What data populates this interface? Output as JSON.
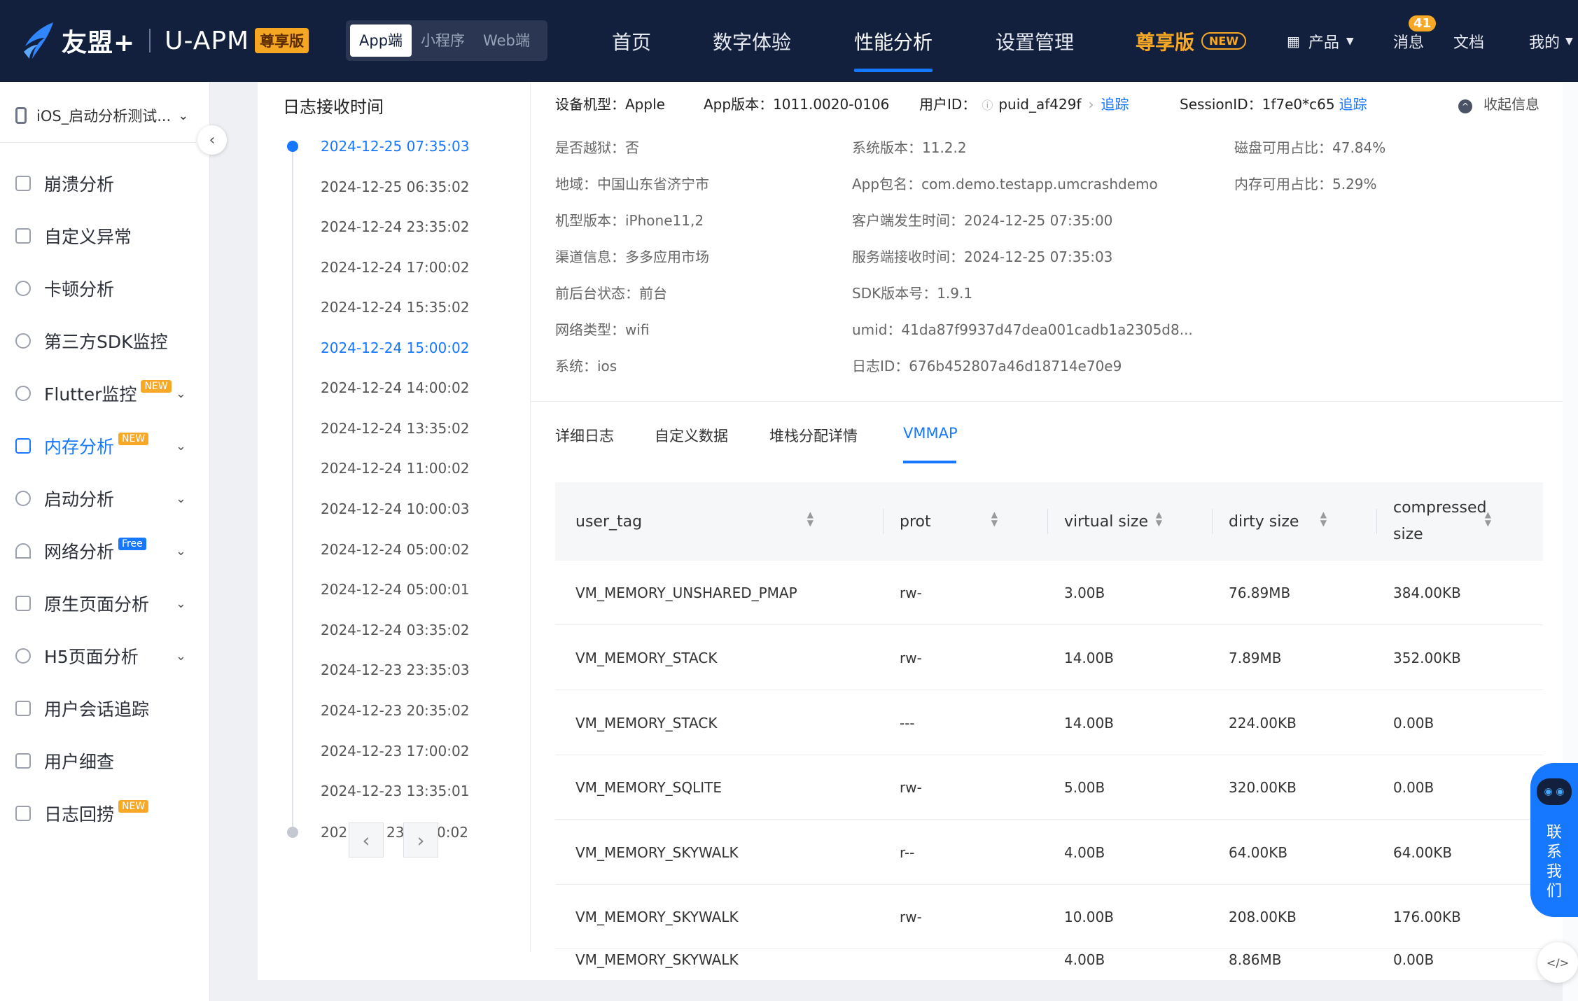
{
  "header": {
    "brand_name": "友盟+",
    "product_name": "U-APM",
    "edition_badge": "尊享版",
    "platform_tabs": [
      "App端",
      "小程序",
      "Web端"
    ],
    "menu": [
      "首页",
      "数字体验",
      "性能分析",
      "设置管理"
    ],
    "active_menu": "性能分析",
    "pro_menu": "尊享版",
    "pro_new": "NEW",
    "products": "产品",
    "messages": "消息",
    "message_count": "41",
    "docs": "文档",
    "mine": "我的"
  },
  "sidebar": {
    "app_name": "iOS_启动分析测试...",
    "items": [
      {
        "label": "崩溃分析",
        "icon": "crash-icon"
      },
      {
        "label": "自定义异常",
        "icon": "chart-icon"
      },
      {
        "label": "卡顿分析",
        "icon": "clock-icon"
      },
      {
        "label": "第三方SDK监控",
        "icon": "sdk-icon"
      },
      {
        "label": "Flutter监控",
        "icon": "flutter-icon",
        "tag": "NEW"
      },
      {
        "label": "内存分析",
        "icon": "save-icon",
        "tag": "NEW",
        "active": true
      },
      {
        "label": "启动分析",
        "icon": "power-icon"
      },
      {
        "label": "网络分析",
        "icon": "wifi-icon",
        "tag": "Free"
      },
      {
        "label": "原生页面分析",
        "icon": "page-icon"
      },
      {
        "label": "H5页面分析",
        "icon": "h5-icon"
      },
      {
        "label": "用户会话追踪",
        "icon": "session-icon"
      },
      {
        "label": "用户细查",
        "icon": "user-icon"
      },
      {
        "label": "日志回捞",
        "icon": "log-icon",
        "tag": "NEW"
      }
    ]
  },
  "timeline": {
    "title": "日志接收时间",
    "entries": [
      "2024-12-25 07:35:03",
      "2024-12-25 06:35:02",
      "2024-12-24 23:35:02",
      "2024-12-24 17:00:02",
      "2024-12-24 15:35:02",
      "2024-12-24 15:00:02",
      "2024-12-24 14:00:02",
      "2024-12-24 13:35:02",
      "2024-12-24 11:00:02",
      "2024-12-24 10:00:03",
      "2024-12-24 05:00:02",
      "2024-12-24 05:00:01",
      "2024-12-24 03:35:02",
      "2024-12-23 23:35:03",
      "2024-12-23 20:35:02",
      "2024-12-23 17:00:02",
      "2024-12-23 13:35:01"
    ],
    "last_partial_prefix": "202",
    "last_partial_mid": "23",
    "last_partial_suffix": "0:02"
  },
  "info": {
    "device_model_label": "设备机型：",
    "device_model": "Apple",
    "app_version_label": "App版本：",
    "app_version": "1011.0020-0106",
    "user_id_label": "用户ID：",
    "user_id": "puid_af429f",
    "trace": "追踪",
    "session_id_label": "SessionID：",
    "session_id": "1f7e0*c65",
    "collapse": "收起信息",
    "col1": [
      "是否越狱：否",
      "地域：中国山东省济宁市",
      "机型版本：iPhone11,2",
      "渠道信息：多多应用市场",
      "前后台状态：前台",
      "网络类型：wifi",
      "系统：ios"
    ],
    "col2": [
      "系统版本：11.2.2",
      "App包名：com.demo.testapp.umcrashdemo",
      "客户端发生时间：2024-12-25 07:35:00",
      "服务端接收时间：2024-12-25 07:35:03",
      "SDK版本号：1.9.1",
      "umid：41da87f9937d47dea001cadb1a2305d8...",
      "日志ID：676b452807a46d18714e70e9"
    ],
    "col3": [
      "磁盘可用占比：47.84%",
      "内存可用占比：5.29%"
    ]
  },
  "tabs": [
    "详细日志",
    "自定义数据",
    "堆栈分配详情",
    "VMMAP"
  ],
  "active_tab": "VMMAP",
  "table": {
    "headers": [
      "user_tag",
      "prot",
      "virtual size",
      "dirty size",
      "compressed size"
    ],
    "rows": [
      [
        "VM_MEMORY_UNSHARED_PMAP",
        "rw-",
        "3.00B",
        "76.89MB",
        "384.00KB"
      ],
      [
        "VM_MEMORY_STACK",
        "rw-",
        "14.00B",
        "7.89MB",
        "352.00KB"
      ],
      [
        "VM_MEMORY_STACK",
        "---",
        "14.00B",
        "224.00KB",
        "0.00B"
      ],
      [
        "VM_MEMORY_SQLITE",
        "rw-",
        "5.00B",
        "320.00KB",
        "0.00B"
      ],
      [
        "VM_MEMORY_SKYWALK",
        "r--",
        "4.00B",
        "64.00KB",
        "64.00KB"
      ],
      [
        "VM_MEMORY_SKYWALK",
        "rw-",
        "10.00B",
        "208.00KB",
        "176.00KB"
      ],
      [
        "VM_MEMORY_SKYWALK",
        "",
        "4.00B",
        "8.86MB",
        "0.00B"
      ]
    ]
  },
  "floating": {
    "contact": "联系我们"
  },
  "colors": {
    "nav_bg": "#13203d",
    "accent": "#1677ff",
    "badge": "#f5a623"
  }
}
